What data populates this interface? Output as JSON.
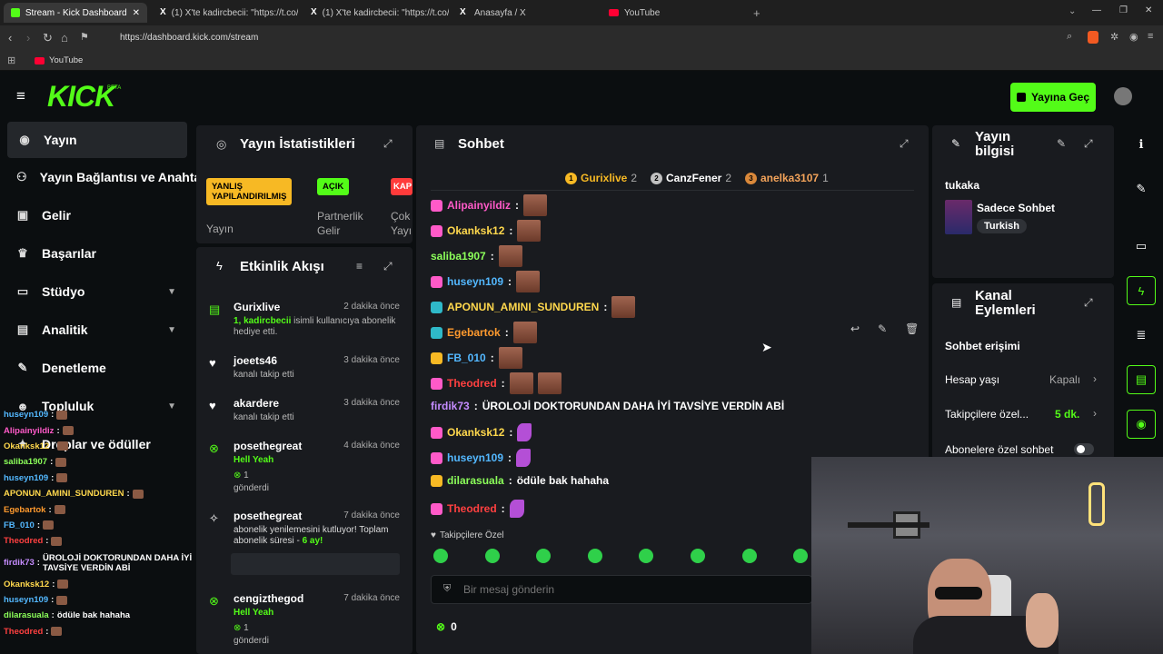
{
  "browser": {
    "tabs": [
      {
        "title": "Stream - Kick Dashboard",
        "icon": "kick-icon"
      },
      {
        "title": "(1) X'te kadircbecii: \"https://t.co/id...",
        "icon": "x-icon"
      },
      {
        "title": "(1) X'te kadircbecii: \"https://t.co/S...",
        "icon": "x-icon"
      },
      {
        "title": "Anasayfa / X",
        "icon": "x-icon"
      },
      {
        "title": "YouTube",
        "icon": "youtube-icon"
      }
    ],
    "url": "https://dashboard.kick.com/stream",
    "bookmark": "YouTube"
  },
  "header": {
    "logo": "KICK",
    "beta": "BETA",
    "go_live": "Yayına Geç"
  },
  "sidebar": {
    "items": [
      {
        "label": "Yayın",
        "icon": "radio-icon"
      },
      {
        "label": "Yayın Bağlantısı ve Anahtarı",
        "icon": "link-icon"
      },
      {
        "label": "Gelir",
        "icon": "wallet-icon"
      },
      {
        "label": "Başarılar",
        "icon": "trophy-icon"
      },
      {
        "label": "Stüdyo",
        "icon": "monitor-icon"
      },
      {
        "label": "Analitik",
        "icon": "chart-icon"
      },
      {
        "label": "Denetleme",
        "icon": "wrench-icon"
      },
      {
        "label": "Topluluk",
        "icon": "people-icon"
      },
      {
        "label": "Droplar ve ödüller",
        "icon": "gift-icon"
      }
    ]
  },
  "overlay_chat": [
    {
      "user": "huseyn109",
      "text": "",
      "color": "#53b8ff"
    },
    {
      "user": "Alipainyildiz",
      "text": "",
      "color": "#ff5ac8"
    },
    {
      "user": "Okanksk12",
      "text": "",
      "color": "#ffd84d"
    },
    {
      "user": "saliba1907",
      "text": "",
      "color": "#8cff5a"
    },
    {
      "user": "huseyn109",
      "text": "",
      "color": "#53b8ff"
    },
    {
      "user": "APONUN_AMINI_SUNDUREN",
      "text": "",
      "color": "#ffd84d"
    },
    {
      "user": "Egebartok",
      "text": "",
      "color": "#ff9a2e"
    },
    {
      "user": "FB_010",
      "text": "",
      "color": "#53b8ff"
    },
    {
      "user": "Theodred",
      "text": "",
      "color": "#ff4040"
    },
    {
      "user": "firdik73",
      "text": "ÜROLOJİ DOKTORUNDAN DAHA İYİ TAVSİYE VERDİN ABİ",
      "color": "#c58cff"
    },
    {
      "user": "Okanksk12",
      "text": "",
      "color": "#ffd84d"
    },
    {
      "user": "huseyn109",
      "text": "",
      "color": "#53b8ff"
    },
    {
      "user": "dilarasuala",
      "text": "ödüle bak hahaha",
      "color": "#8cff5a"
    },
    {
      "user": "Theodred",
      "text": "",
      "color": "#ff4040"
    }
  ],
  "stats": {
    "title": "Yayın İstatistikleri",
    "badges": [
      {
        "label": "YANLIŞ YAPILANDIRILMIŞ",
        "caption": "Yayın",
        "bg": "#f7b924"
      },
      {
        "label": "AÇIK",
        "caption": "Partnerlik Gelir",
        "bg": "#53fc18"
      },
      {
        "label": "KAP",
        "caption": "Çok Yayı",
        "bg": "#ff3b3b"
      }
    ]
  },
  "activity": {
    "title": "Etkinlik Akışı",
    "items": [
      {
        "name": "Gurixlive",
        "time": "2 dakika önce",
        "desc_highlight": "1, kadircbecii",
        "desc": "isimli kullanıcıya abonelik hediye etti.",
        "icon": "gift-icon"
      },
      {
        "name": "joeets46",
        "time": "3 dakika önce",
        "desc": "kanalı takip etti",
        "icon": "heart-icon"
      },
      {
        "name": "akardere",
        "time": "3 dakika önce",
        "desc": "kanalı takip etti",
        "icon": "heart-icon"
      },
      {
        "name": "posethegreat",
        "time": "4 dakika önce",
        "highlight": "Hell Yeah",
        "count": "1",
        "desc": "gönderdi",
        "icon": "kick-coin-icon"
      },
      {
        "name": "posethegreat",
        "time": "7 dakika önce",
        "desc": "abonelik yenilemesini kutluyor! Toplam abonelik süresi - ",
        "months": "6 ay!",
        "icon": "star-icon"
      },
      {
        "name": "cengizthegod",
        "time": "7 dakika önce",
        "highlight": "Hell Yeah",
        "count": "1",
        "desc": "gönderdi",
        "icon": "kick-coin-icon"
      }
    ]
  },
  "chat": {
    "title": "Sohbet",
    "leaders": [
      {
        "rank": "1",
        "name": "Gurixlive",
        "count": "2",
        "color": "#f7b924"
      },
      {
        "rank": "2",
        "name": "CanzFener",
        "count": "2",
        "color": "#c0c0c0"
      },
      {
        "rank": "3",
        "name": "anelka3107",
        "count": "1",
        "color": "#d9883a"
      }
    ],
    "messages": [
      {
        "user": "Alipainyildiz",
        "color": "#ff5ac8",
        "text": "",
        "badge_color": "#ff5ac8",
        "kind": "face"
      },
      {
        "user": "Okanksk12",
        "color": "#ffd84d",
        "text": "",
        "badge_color": "#ff5ac8",
        "kind": "face"
      },
      {
        "user": "saliba1907",
        "color": "#8cff5a",
        "text": "",
        "badge_color": "",
        "kind": "face"
      },
      {
        "user": "huseyn109",
        "color": "#53b8ff",
        "text": "",
        "badge_color": "#ff5ac8",
        "kind": "face"
      },
      {
        "user": "APONUN_AMINI_SUNDUREN",
        "color": "#ffd84d",
        "text": "",
        "badge_color": "#2fb9c9",
        "kind": "face"
      },
      {
        "user": "Egebartok",
        "color": "#ff9a2e",
        "text": "",
        "badge_color": "#2fb9c9",
        "kind": "face"
      },
      {
        "user": "FB_010",
        "color": "#53b8ff",
        "text": "",
        "badge_color": "#f7b924",
        "kind": "face"
      },
      {
        "user": "Theodred",
        "color": "#ff4040",
        "text": "",
        "badge_color": "#ff5ac8",
        "kind": "faces"
      },
      {
        "user": "firdik73",
        "color": "#c58cff",
        "text": "ÜROLOJİ DOKTORUNDAN DAHA İYİ TAVSİYE VERDİN ABİ",
        "badge_color": "",
        "kind": "text"
      },
      {
        "user": "Okanksk12",
        "color": "#ffd84d",
        "text": "",
        "badge_color": "#ff5ac8",
        "kind": "sticker"
      },
      {
        "user": "huseyn109",
        "color": "#53b8ff",
        "text": "",
        "badge_color": "#ff5ac8",
        "kind": "sticker"
      },
      {
        "user": "dilarasuala",
        "color": "#8cff5a",
        "text": "ödüle bak hahaha",
        "badge_color": "#f7b924",
        "kind": "text"
      },
      {
        "user": "Theodred",
        "color": "#ff4040",
        "text": "",
        "badge_color": "#ff5ac8",
        "kind": "sticker"
      }
    ],
    "emote_section": "Takipçilere Özel",
    "input_placeholder": "Bir mesaj gönderin",
    "coins": "0"
  },
  "stream_info": {
    "title": "Yayın bilgisi",
    "channel": "tukaka",
    "category": "Sadece Sohbet",
    "language": "Turkish"
  },
  "channel_actions": {
    "title": "Kanal Eylemleri",
    "section": "Sohbet erişimi",
    "rows": [
      {
        "label": "Hesap yaşı",
        "value": "Kapalı"
      },
      {
        "label": "Takipçilere özel...",
        "value": "5 dk."
      },
      {
        "label": "Abonelere özel sohbet",
        "value": ""
      }
    ]
  },
  "colors": {
    "brand": "#53fc18",
    "panel": "#191b1f",
    "bg": "#0b0e10"
  }
}
